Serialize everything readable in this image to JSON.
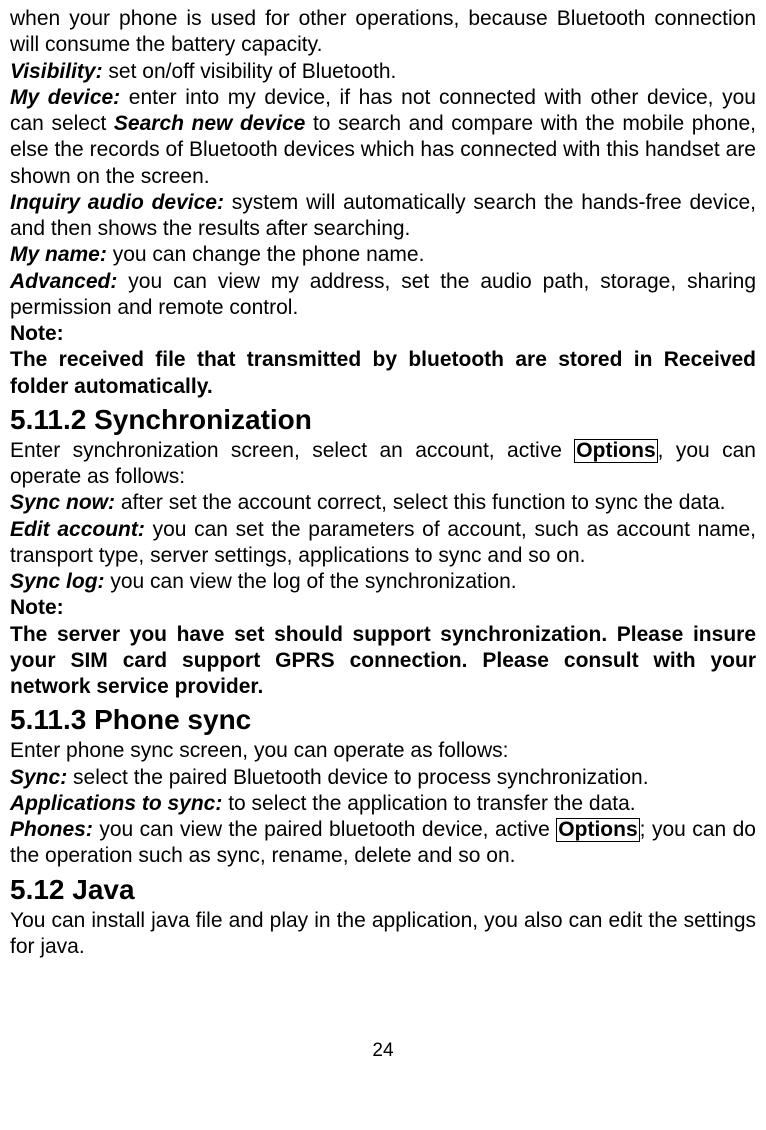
{
  "lines": {
    "intro1": "when your phone is used for other operations, because Bluetooth connection will consume the battery capacity.",
    "visibility_label": "Visibility:",
    "visibility_text": " set on/off visibility of Bluetooth.",
    "mydevice_label": "My device:",
    "mydevice_text1": " enter into my device, if has not connected with other device, you can select ",
    "mydevice_em": "Search new device",
    "mydevice_text2": " to search and compare with the mobile phone, else the records of Bluetooth devices which has connected with this handset are shown on the screen.",
    "inquiry_label": "Inquiry audio device:",
    "inquiry_text": " system will automatically search the hands-free device, and then shows the results after searching.",
    "myname_label": "My name:",
    "myname_text": " you can change the phone name.",
    "advanced_label": "Advanced:",
    "advanced_text": " you can view my address, set the audio path, storage, sharing permission and remote control.",
    "note1": "Note:",
    "note1_text": "The received file that transmitted by bluetooth are stored in Received folder automatically.",
    "h1": "5.11.2 Synchronization",
    "sync_intro1": "Enter synchronization screen, select an account, active ",
    "options1": "Options",
    "sync_intro2": ", you can operate as follows:",
    "syncnow_label": "Sync now:",
    "syncnow_text": " after set the account correct, select this function to sync the data.",
    "editacc_label": "Edit account:",
    "editacc_text": " you can set the parameters of account, such as account name, transport type, server settings, applications to sync and so on.",
    "synclog_label": "Sync log:",
    "synclog_text": " you can view the log of the synchronization.",
    "note2": "Note:",
    "note2_text": "The server you have set should support synchronization. Please insure your SIM card support GPRS connection. Please consult with your network service provider.",
    "h2": "5.11.3 Phone sync",
    "phonesync_intro": "Enter phone sync screen, you can operate as follows:",
    "sync_label": "Sync:",
    "sync_text": " select the paired Bluetooth device to process synchronization.",
    "apps_label": "Applications to sync:",
    "apps_text": " to select the application to transfer the data.",
    "phones_label": "Phones:",
    "phones_text1": " you can view the paired bluetooth device, active ",
    "options2": "Options",
    "phones_text2": "; you can do the operation such as sync, rename, delete and so on.",
    "h3": "5.12 Java",
    "java_text": "You can install java file and play in the application, you also can edit the settings for java.",
    "page_num": "24"
  }
}
